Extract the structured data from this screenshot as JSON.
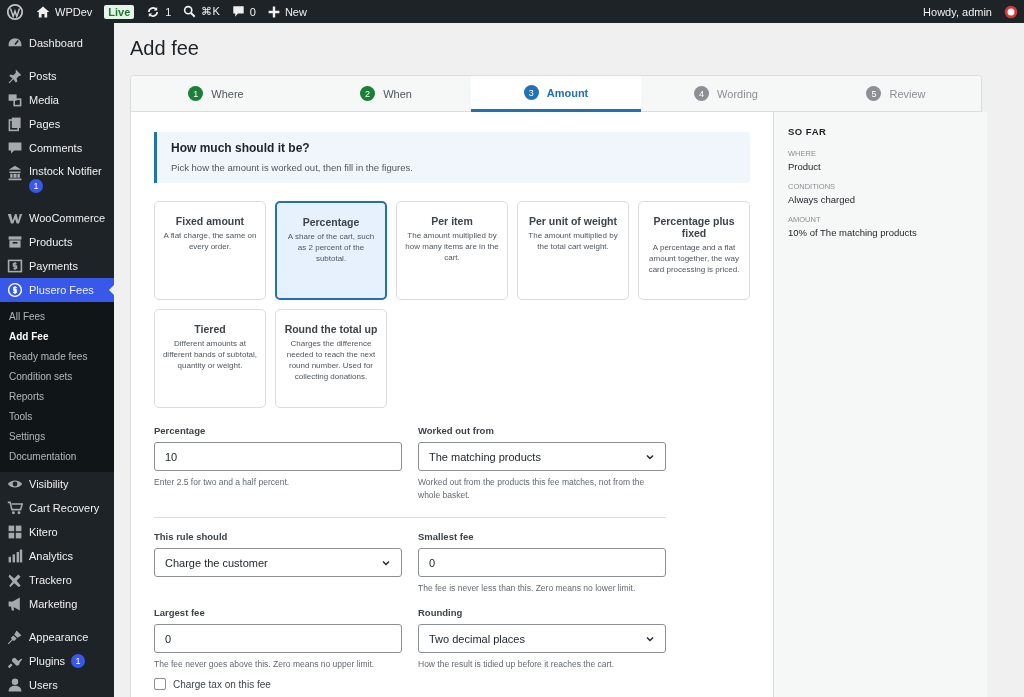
{
  "admin_bar": {
    "site_name": "WPDev",
    "environment_badge": "Live",
    "updates_count": "1",
    "search_shortcut": "⌘K",
    "comments_count": "0",
    "new_label": "New",
    "greeting": "Howdy, admin"
  },
  "sidebar": {
    "groups": [
      [
        {
          "label": "Dashboard",
          "kind": "gauge",
          "current": false
        }
      ],
      [
        {
          "label": "Posts",
          "kind": "pin",
          "current": false
        },
        {
          "label": "Media",
          "kind": "media",
          "current": false
        },
        {
          "label": "Pages",
          "kind": "pages",
          "current": false
        },
        {
          "label": "Comments",
          "kind": "comment",
          "current": false
        },
        {
          "label": "Instock Notifier",
          "kind": "bank",
          "current": false,
          "badge": "1"
        }
      ],
      [
        {
          "label": "WooCommerce",
          "kind": "woo",
          "current": false
        },
        {
          "label": "Products",
          "kind": "archive",
          "current": false
        },
        {
          "label": "Payments",
          "kind": "dollar-box",
          "current": false
        },
        {
          "label": "Plusero Fees",
          "kind": "dollar-coin",
          "current": true,
          "children": [
            {
              "label": "All Fees",
              "selected": false
            },
            {
              "label": "Add Fee",
              "selected": true
            },
            {
              "label": "Ready made fees",
              "selected": false
            },
            {
              "label": "Condition sets",
              "selected": false
            },
            {
              "label": "Reports",
              "selected": false
            },
            {
              "label": "Tools",
              "selected": false
            },
            {
              "label": "Settings",
              "selected": false
            },
            {
              "label": "Documentation",
              "selected": false
            }
          ]
        },
        {
          "label": "Visibility",
          "kind": "eye",
          "current": false
        },
        {
          "label": "Cart Recovery",
          "kind": "cart",
          "current": false
        },
        {
          "label": "Kitero",
          "kind": "grid",
          "current": false
        },
        {
          "label": "Analytics",
          "kind": "bars",
          "current": false
        },
        {
          "label": "Trackero",
          "kind": "plane",
          "current": false
        },
        {
          "label": "Marketing",
          "kind": "megaphone",
          "current": false
        }
      ],
      [
        {
          "label": "Appearance",
          "kind": "brush",
          "current": false
        },
        {
          "label": "Plugins",
          "kind": "plug",
          "current": false,
          "badge": "1"
        },
        {
          "label": "Users",
          "kind": "user",
          "current": false
        }
      ]
    ]
  },
  "page_title": "Add fee",
  "steps": [
    {
      "number": "1",
      "label": "Where",
      "completed": true,
      "selected": false
    },
    {
      "number": "2",
      "label": "When",
      "completed": true,
      "selected": false
    },
    {
      "number": "3",
      "label": "Amount",
      "completed": false,
      "selected": true
    },
    {
      "number": "4",
      "label": "Wording",
      "completed": false,
      "selected": false
    },
    {
      "number": "5",
      "label": "Review",
      "completed": false,
      "selected": false
    }
  ],
  "notice": {
    "title": "How much should it be?",
    "text": "Pick how the amount is worked out, then fill in the figures."
  },
  "methods": [
    {
      "title": "Fixed amount",
      "description": "A flat charge, the same on every order.",
      "selected": false
    },
    {
      "title": "Percentage",
      "description": "A share of the cart, such as 2 percent of the subtotal.",
      "selected": true
    },
    {
      "title": "Per item",
      "description": "The amount multiplied by how many items are in the cart.",
      "selected": false
    },
    {
      "title": "Per unit of weight",
      "description": "The amount multiplied by the total cart weight.",
      "selected": false
    },
    {
      "title": "Percentage plus fixed",
      "description": "A percentage and a flat amount together, the way card processing is priced.",
      "selected": false
    },
    {
      "title": "Tiered",
      "description": "Different amounts at different bands of subtotal, quantity or weight.",
      "selected": false
    },
    {
      "title": "Round the total up",
      "description": "Charges the difference needed to reach the next round number. Used for collecting donations.",
      "selected": false
    }
  ],
  "field_groups": [
    [
      {
        "label": "Percentage",
        "kind": "text",
        "value": "10",
        "help": "Enter 2.5 for two and a half percent."
      },
      {
        "label": "Worked out from",
        "kind": "select",
        "value": "The matching products",
        "help": "Worked out from the products this fee matches, not from the whole basket."
      }
    ],
    [
      {
        "label": "This rule should",
        "kind": "select",
        "value": "Charge the customer"
      },
      {
        "label": "Smallest fee",
        "kind": "text",
        "value": "0",
        "help": "The fee is never less than this. Zero means no lower limit."
      },
      {
        "label": "Largest fee",
        "kind": "text",
        "value": "0",
        "help": "The fee never goes above this. Zero means no upper limit."
      },
      {
        "label": "Rounding",
        "kind": "select",
        "value": "Two decimal places",
        "help": "How the result is tidied up before it reaches the cart."
      }
    ]
  ],
  "tax_option": {
    "label": "Charge tax on this fee",
    "checked": false
  },
  "summary": {
    "title": "SO FAR",
    "entries": [
      {
        "label": "WHERE",
        "value": "Product"
      },
      {
        "label": "CONDITIONS",
        "value": "Always charged"
      },
      {
        "label": "AMOUNT",
        "value": "10% of The matching products"
      }
    ]
  }
}
